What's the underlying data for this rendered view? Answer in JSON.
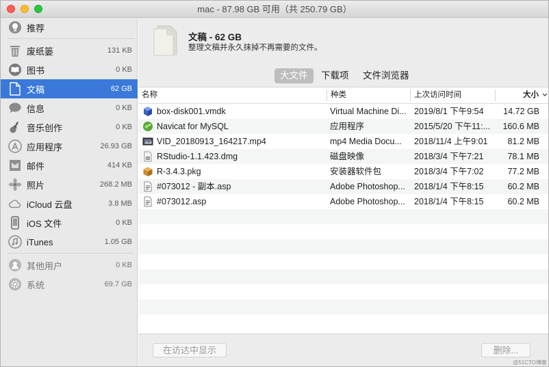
{
  "window": {
    "title": "mac - 87.98 GB 可用（共 250.79 GB）",
    "traffic": {
      "close": "#fd5f57",
      "minimize": "#febc2e",
      "maximize": "#28c840"
    }
  },
  "sidebar": {
    "items": [
      {
        "label": "推荐",
        "size": "",
        "icon": "lightbulb-icon"
      },
      {
        "label": "废纸篓",
        "size": "131 KB",
        "icon": "trash-icon"
      },
      {
        "label": "图书",
        "size": "0 KB",
        "icon": "book-icon"
      },
      {
        "label": "文稿",
        "size": "62 GB",
        "icon": "document-icon"
      },
      {
        "label": "信息",
        "size": "0 KB",
        "icon": "message-icon"
      },
      {
        "label": "音乐创作",
        "size": "0 KB",
        "icon": "guitar-icon"
      },
      {
        "label": "应用程序",
        "size": "26.93 GB",
        "icon": "app-store-icon"
      },
      {
        "label": "邮件",
        "size": "414 KB",
        "icon": "mail-icon"
      },
      {
        "label": "照片",
        "size": "268.2 MB",
        "icon": "photos-icon"
      },
      {
        "label": "iCloud 云盘",
        "size": "3.8 MB",
        "icon": "cloud-icon"
      },
      {
        "label": "iOS 文件",
        "size": "0 KB",
        "icon": "iphone-icon"
      },
      {
        "label": "iTunes",
        "size": "1.05 GB",
        "icon": "music-icon"
      },
      {
        "label": "其他用户",
        "size": "0 KB",
        "icon": "users-icon"
      },
      {
        "label": "系统",
        "size": "69.7 GB",
        "icon": "gear-icon"
      }
    ],
    "selected_color": "#3a79d9"
  },
  "header": {
    "title": "文稿 - 62 GB",
    "subtitle": "整理文稿并永久抹掉不再需要的文件。"
  },
  "tabs": [
    "大文件",
    "下载项",
    "文件浏览器"
  ],
  "columns": {
    "name": "名称",
    "kind": "种类",
    "accessed": "上次访问时间",
    "size": "大小"
  },
  "files": [
    {
      "name": "box-disk001.vmdk",
      "kind": "Virtual Machine Di...",
      "date": "2019/8/1 下午9:54",
      "size": "14.72 GB",
      "icon": "vmdk-cube-icon"
    },
    {
      "name": "Navicat for MySQL",
      "kind": "应用程序",
      "date": "2015/5/20 下午11:...",
      "size": "160.6 MB",
      "icon": "navicat-icon"
    },
    {
      "name": "VID_20180913_164217.mp4",
      "kind": "mp4 Media Docu...",
      "date": "2018/11/4 上午9:01",
      "size": "81.2 MB",
      "icon": "video-file-icon"
    },
    {
      "name": "RStudio-1.1.423.dmg",
      "kind": "磁盘映像",
      "date": "2018/3/4 下午7:21",
      "size": "78.1 MB",
      "icon": "disk-image-icon"
    },
    {
      "name": "R-3.4.3.pkg",
      "kind": "安装器软件包",
      "date": "2018/3/4 下午7:02",
      "size": "77.2 MB",
      "icon": "package-icon"
    },
    {
      "name": "#073012 - 副本.asp",
      "kind": "Adobe Photoshop...",
      "date": "2018/1/4 下午8:15",
      "size": "60.2 MB",
      "icon": "asp-file-icon"
    },
    {
      "name": "#073012.asp",
      "kind": "Adobe Photoshop...",
      "date": "2018/1/4 下午8:15",
      "size": "60.2 MB",
      "icon": "asp-file-icon"
    }
  ],
  "footer": {
    "show_in_finder": "在访达中显示",
    "delete": "删除..."
  },
  "watermark": "@51CTO博客"
}
